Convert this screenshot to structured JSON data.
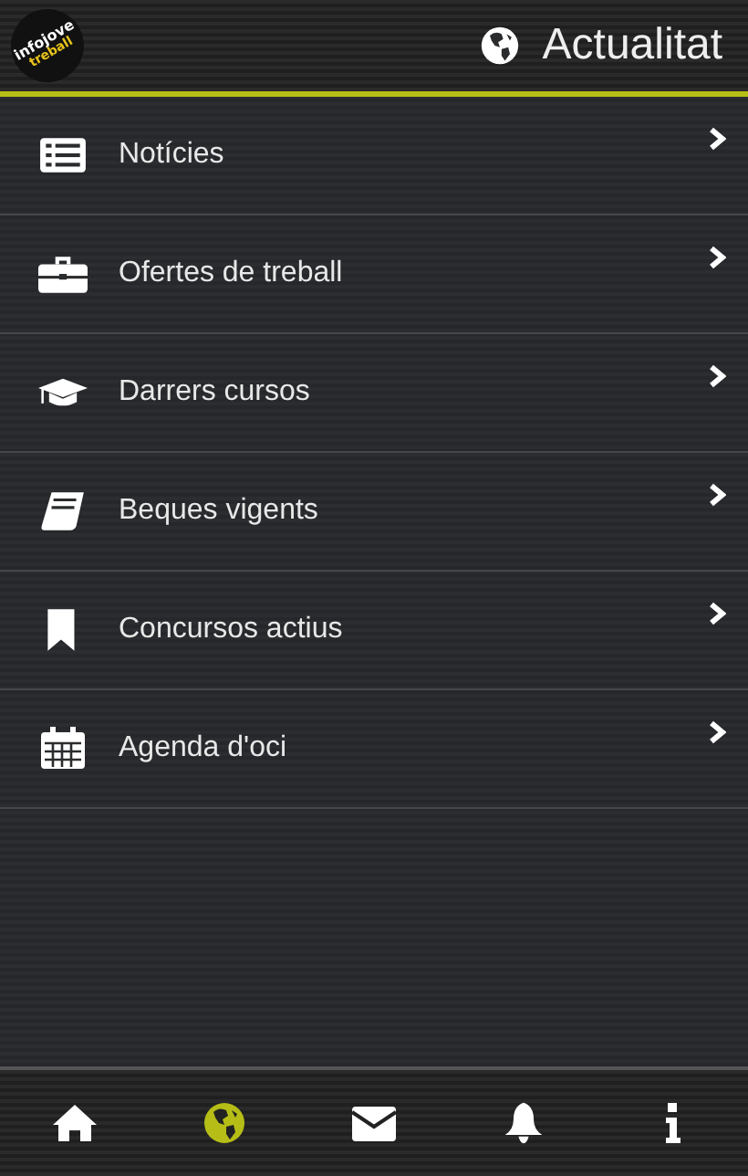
{
  "header": {
    "logo": {
      "line_1": "infojove",
      "line_2": "treball"
    },
    "title": "Actualitat"
  },
  "menu": [
    {
      "label": "Notícies",
      "kind": "list"
    },
    {
      "label": "Ofertes de treball",
      "kind": "briefcase"
    },
    {
      "label": "Darrers cursos",
      "kind": "cap"
    },
    {
      "label": "Beques vigents",
      "kind": "book"
    },
    {
      "label": "Concursos actius",
      "kind": "bookmark"
    },
    {
      "label": "Agenda d'oci",
      "kind": "calendar"
    }
  ],
  "nav": [
    {
      "kind": "home",
      "selected": false
    },
    {
      "kind": "globe",
      "selected": true
    },
    {
      "kind": "mail",
      "selected": false
    },
    {
      "kind": "bell",
      "selected": false
    },
    {
      "kind": "info",
      "selected": false
    }
  ]
}
